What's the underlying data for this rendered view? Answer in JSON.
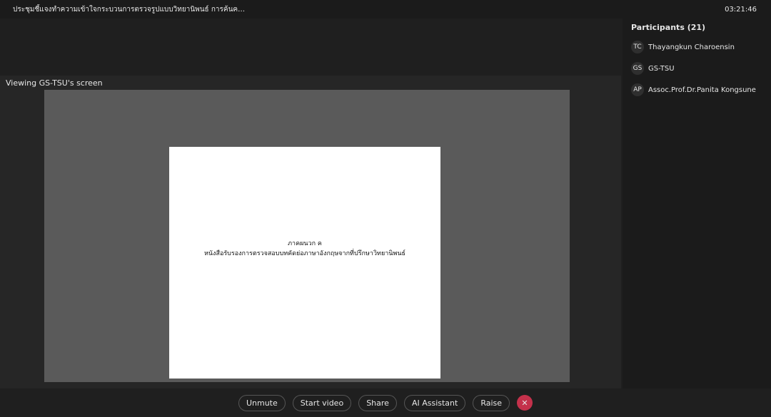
{
  "topbar": {
    "title": "ประชุมชี้แจงทำความเข้าใจกระบวนการตรวจรูปแบบวิทยานิพนธ์ การค้นคว้าอิสระ และดุษฎีนิพนธ์ ของนิสิตระดับบัณฑิตศึกษา",
    "time": "03:21:46"
  },
  "stage": {
    "viewing": "Viewing GS-TSU's screen",
    "page_line1": "ภาคผนวก ค",
    "page_line2": "หนังสือรับรองการตรวจสอบบทคัดย่อภาษาอังกฤษจากที่ปรึกษาวิทยานิพนธ์"
  },
  "participants": {
    "title": "Participants (21)",
    "items": [
      {
        "name": "Thayangkun Charoensin",
        "initials": "TC"
      },
      {
        "name": "GS-TSU",
        "initials": "GS"
      },
      {
        "name": "Assoc.Prof.Dr.Panita Kongsune",
        "initials": "AP"
      }
    ]
  },
  "bottombar": {
    "unmute": "Unmute",
    "start_video": "Start video",
    "share": "Share",
    "assistant": "AI Assistant",
    "raise": "Raise",
    "leave": "✕"
  }
}
